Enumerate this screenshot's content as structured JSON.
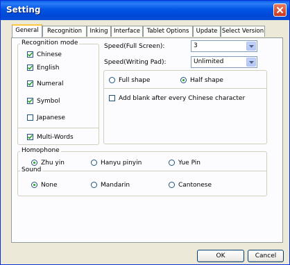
{
  "window": {
    "title": "Setting"
  },
  "tabs": [
    "General",
    "Recognition",
    "Inking",
    "Interface",
    "Tablet Options",
    "Update",
    "Select Version"
  ],
  "recognition_mode": {
    "label": "Recognition mode",
    "items": [
      {
        "label": "Chinese",
        "checked": true
      },
      {
        "label": "English",
        "checked": true
      },
      {
        "label": "Numeral",
        "checked": true
      },
      {
        "label": "Symbol",
        "checked": true
      },
      {
        "label": "Japanese",
        "checked": false
      }
    ],
    "multi_words": {
      "label": "Multi-Words",
      "checked": true
    }
  },
  "speed": {
    "full_label": "Speed(Full Screen):",
    "full_value": "3",
    "pad_label": "Speed(Writing Pad):",
    "pad_value": "Unlimited"
  },
  "shape": {
    "full": {
      "label": "Full shape",
      "selected": false
    },
    "half": {
      "label": "Half shape",
      "selected": true
    }
  },
  "add_blank": {
    "label": "Add blank after every Chinese character",
    "checked": false
  },
  "homophone": {
    "label": "Homophone",
    "options": [
      {
        "label": "Zhu yin",
        "selected": true
      },
      {
        "label": "Hanyu pinyin",
        "selected": false
      },
      {
        "label": "Yue Pin",
        "selected": false
      }
    ]
  },
  "sound": {
    "label": "Sound",
    "options": [
      {
        "label": "None",
        "selected": true
      },
      {
        "label": "Mandarin",
        "selected": false
      },
      {
        "label": "Cantonese",
        "selected": false
      }
    ]
  },
  "buttons": {
    "ok": "OK",
    "cancel": "Cancel"
  }
}
